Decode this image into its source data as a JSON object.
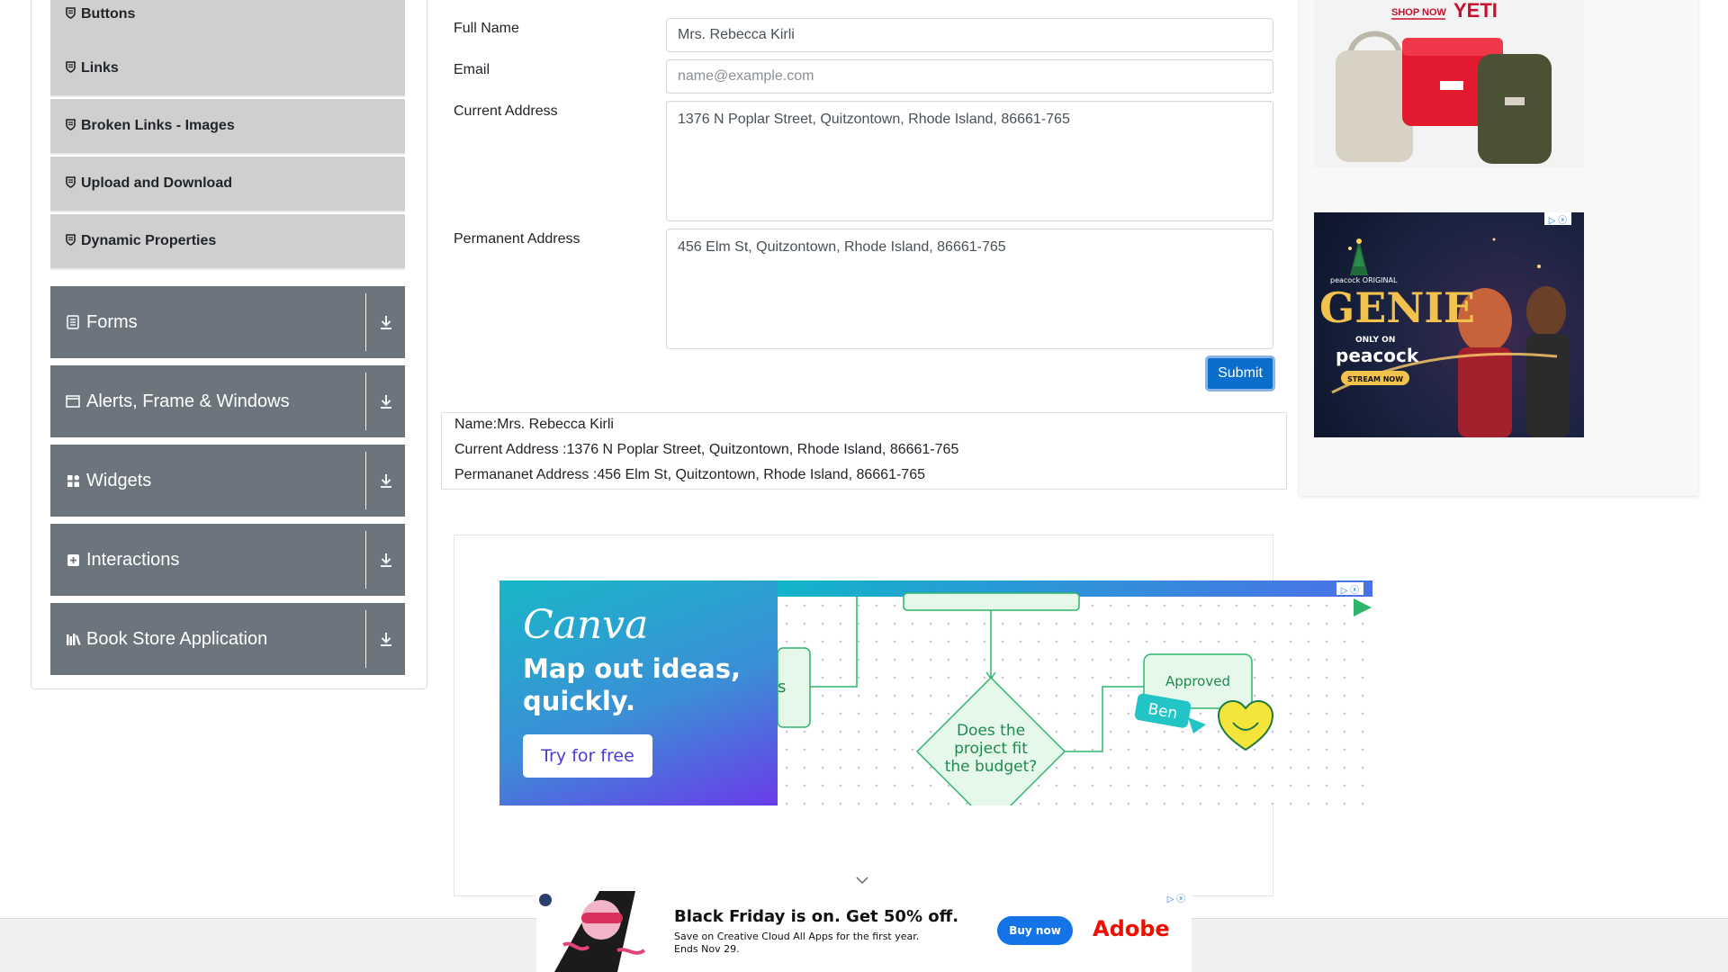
{
  "sidebar": {
    "sub_items": [
      {
        "label": "Buttons"
      },
      {
        "label": "Links"
      },
      {
        "label": "Broken Links - Images"
      },
      {
        "label": "Upload and Download"
      },
      {
        "label": "Dynamic Properties"
      }
    ],
    "groups": [
      {
        "label": "Forms",
        "icon": "document-icon"
      },
      {
        "label": "Alerts, Frame & Windows",
        "icon": "window-icon"
      },
      {
        "label": "Widgets",
        "icon": "widgets-icon"
      },
      {
        "label": "Interactions",
        "icon": "interactions-icon"
      },
      {
        "label": "Book Store Application",
        "icon": "books-icon"
      }
    ]
  },
  "form": {
    "full_name_label": "Full Name",
    "full_name_value": "Mrs. Rebecca Kirli",
    "email_label": "Email",
    "email_placeholder": "name@example.com",
    "current_address_label": "Current Address",
    "current_address_value": "1376 N Poplar Street, Quitzontown, Rhode Island, 86661-765",
    "permanent_address_label": "Permanent Address",
    "permanent_address_value": "456 Elm St, Quitzontown, Rhode Island, 86661-765",
    "submit_label": "Submit"
  },
  "output": {
    "name_line": "Name:Mrs. Rebecca Kirli",
    "current_line": "Current Address :1376 N Poplar Street, Quitzontown, Rhode Island, 86661-765",
    "permanent_line": "Permananet Address :456 Elm St, Quitzontown, Rhode Island, 86661-765"
  },
  "ads": {
    "yeti": {
      "shop_now": "SHOP NOW",
      "brand": "YETI"
    },
    "genie": {
      "network": "peacock ORIGINAL",
      "title": "GENIE",
      "only_on": "ONLY ON",
      "peacock": "peacock",
      "stream": "STREAM NOW"
    },
    "canva": {
      "logo": "Canva",
      "headline": "Map out ideas, quickly.",
      "cta": "Try for free",
      "diagram_left": "s",
      "diagram_question": "Does the project fit the budget?",
      "diagram_approved": "Approved",
      "diagram_name": "Ben"
    },
    "adobe": {
      "title": "Black Friday is on. Get 50% off.",
      "subtitle": "Save on Creative Cloud All Apps for the first year. Ends Nov 29.",
      "cta": "Buy now",
      "brand": "Adobe"
    }
  },
  "colors": {
    "submit_bg": "#0a6ecd",
    "sidebar_group_bg": "#6c757d",
    "sidebar_sub_bg": "#cfcfcf"
  }
}
